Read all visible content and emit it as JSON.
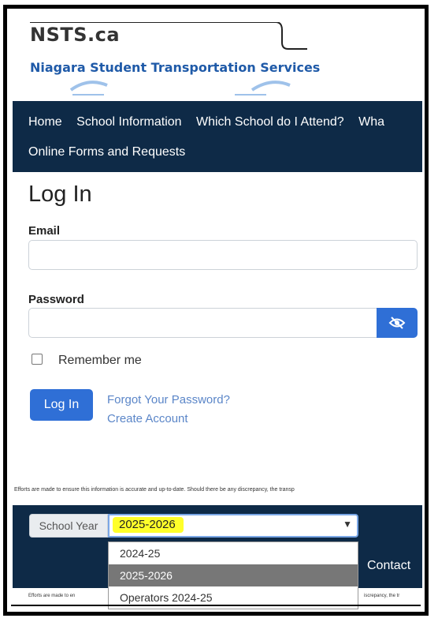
{
  "logo": {
    "short_name": "NSTS.ca",
    "full_name": "Niagara Student Transportation Services"
  },
  "nav": {
    "items": [
      "Home",
      "School Information",
      "Which School do I Attend?",
      "Wha",
      "Online Forms and Requests"
    ]
  },
  "page": {
    "title": "Log In"
  },
  "form": {
    "email_label": "Email",
    "email_value": "",
    "password_label": "Password",
    "password_value": "",
    "remember_label": "Remember me",
    "remember_checked": false,
    "login_button": "Log In",
    "forgot_link": "Forgot Your Password?",
    "create_link": "Create Account"
  },
  "disclaimer": {
    "text1": "Efforts are made to ensure this information is accurate and up-to-date. Should there be any discrepancy, the transp",
    "text2_left": "Efforts are made to en",
    "text2_right": "iscrepancy, the tr"
  },
  "footer": {
    "school_year_label": "School Year",
    "selected_year": "2025-2026",
    "options": [
      "2024-25",
      "2025-2026",
      "Operators 2024-25"
    ],
    "contact_label": "Contact"
  },
  "colors": {
    "nav_bg": "#0e2a47",
    "primary_button": "#2f6fd6",
    "highlight": "#ffff2a",
    "link": "#5b86c8"
  },
  "icons": {
    "password_toggle": "eye-slash-icon",
    "dropdown": "chevron-down-icon"
  }
}
